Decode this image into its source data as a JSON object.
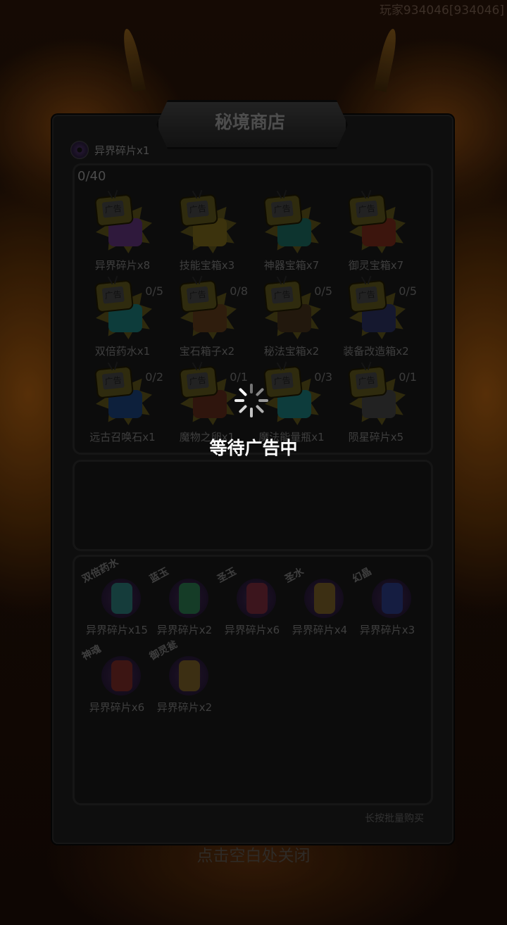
{
  "player_id": "玩家934046[934046]",
  "shop": {
    "title": "秘境商店",
    "currency_label": "异界碎片x1",
    "ad_counter": "0/40",
    "bulk_hint": "长按批量购买",
    "close_hint": "点击空白处关闭",
    "ad_badge": "广告",
    "ad_items": [
      {
        "name": "异界碎片x8",
        "count": "",
        "color": "#3a1f4a"
      },
      {
        "name": "技能宝箱x3",
        "count": "",
        "color": "#4a3f10"
      },
      {
        "name": "神器宝箱x7",
        "count": "",
        "color": "#10403a"
      },
      {
        "name": "御灵宝箱x7",
        "count": "",
        "color": "#4a1a10"
      },
      {
        "name": "双倍药水x1",
        "count": "0/5",
        "color": "#104a48"
      },
      {
        "name": "宝石箱子x2",
        "count": "0/8",
        "color": "#3a2410"
      },
      {
        "name": "秘法宝箱x2",
        "count": "0/5",
        "color": "#2a1e10"
      },
      {
        "name": "装备改造箱x2",
        "count": "0/5",
        "color": "#1a1e3a"
      },
      {
        "name": "远古召唤石x1",
        "count": "0/2",
        "color": "#10284a"
      },
      {
        "name": "魔物之卵x1",
        "count": "0/1",
        "color": "#3a1a10"
      },
      {
        "name": "魔法能量瓶x1",
        "count": "0/3",
        "color": "#104a4a"
      },
      {
        "name": "陨星碎片x5",
        "count": "0/1",
        "color": "#2a2a2a"
      }
    ],
    "exchange_items": [
      {
        "tag": "双倍药水",
        "name": "异界碎片x15",
        "color": "#1a4a48"
      },
      {
        "tag": "蓝玉",
        "name": "异界碎片x2",
        "color": "#1a4a30"
      },
      {
        "tag": "圣玉",
        "name": "异界碎片x6",
        "color": "#4a1a24"
      },
      {
        "tag": "圣水",
        "name": "异界碎片x4",
        "color": "#4a3a18"
      },
      {
        "tag": "幻晶",
        "name": "异界碎片x3",
        "color": "#1a2450"
      },
      {
        "tag": "神魂",
        "name": "异界碎片x6",
        "color": "#4a1a18"
      },
      {
        "tag": "御灵瓮",
        "name": "异界碎片x2",
        "color": "#4a3a18"
      }
    ]
  },
  "loading": {
    "text": "等待广告中"
  }
}
